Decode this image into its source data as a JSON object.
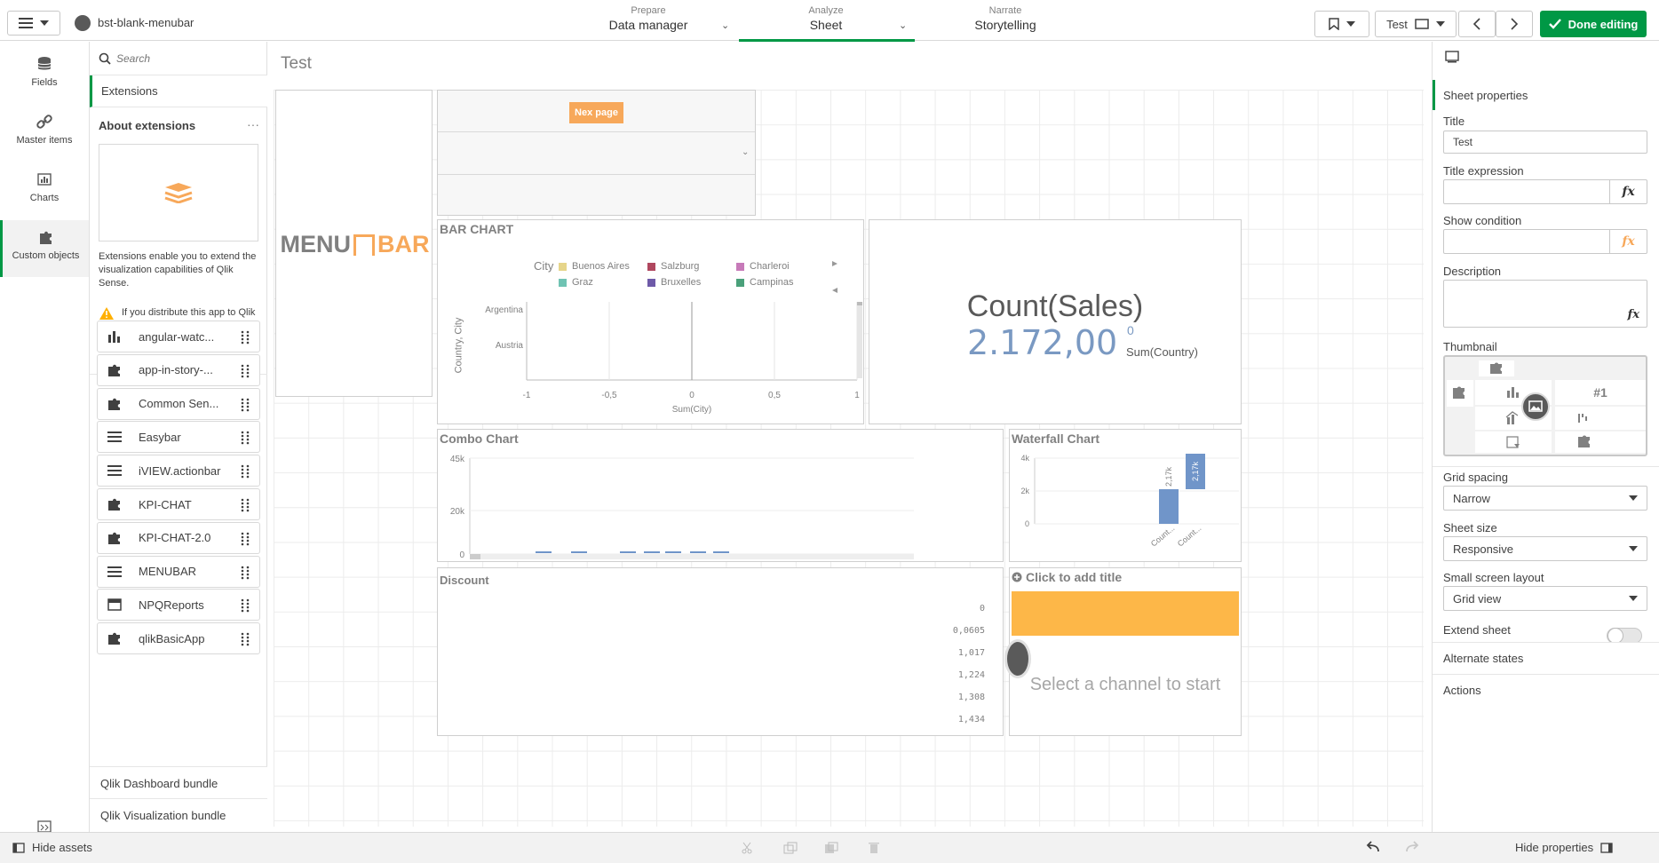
{
  "header": {
    "app_name": "bst-blank-menubar",
    "tabs": [
      {
        "small": "Prepare",
        "big": "Data manager"
      },
      {
        "small": "Analyze",
        "big": "Sheet"
      },
      {
        "small": "Narrate",
        "big": "Storytelling"
      }
    ],
    "sheet_selector": "Test",
    "done_label": "Done editing"
  },
  "rail": {
    "items": [
      {
        "label": "Fields",
        "icon": "database-icon"
      },
      {
        "label": "Master items",
        "icon": "link-icon"
      },
      {
        "label": "Charts",
        "icon": "bar-chart-icon"
      },
      {
        "label": "Custom objects",
        "icon": "puzzle-icon"
      }
    ]
  },
  "assets": {
    "search_placeholder": "Search",
    "tab": "Extensions",
    "about_title": "About extensions",
    "about_text": "Extensions enable you to extend the visualization capabilities of Qlik Sense.",
    "warning_text": "If you distribute this app to Qlik Cloud Services, extensions will not be available.",
    "items": [
      {
        "label": "angular-watc...",
        "icon": "bar-chart-icon"
      },
      {
        "label": "app-in-story-...",
        "icon": "puzzle-icon"
      },
      {
        "label": "Common Sen...",
        "icon": "puzzle-icon"
      },
      {
        "label": "Easybar",
        "icon": "lines-icon"
      },
      {
        "label": "iVIEW.actionbar",
        "icon": "lines-icon"
      },
      {
        "label": "KPI-CHAT",
        "icon": "puzzle-icon"
      },
      {
        "label": "KPI-CHAT-2.0",
        "icon": "puzzle-icon"
      },
      {
        "label": "MENUBAR",
        "icon": "lines-icon"
      },
      {
        "label": "NPQReports",
        "icon": "report-icon"
      },
      {
        "label": "qlikBasicApp",
        "icon": "puzzle-icon"
      }
    ],
    "bundles": [
      "Qlik Dashboard bundle",
      "Qlik Visualization bundle"
    ]
  },
  "canvas": {
    "sheet_title": "Test",
    "menubar_logo_left": "MENU",
    "menubar_logo_right": "BAR",
    "nex_page_label": "Nex page",
    "bar_chart": {
      "title": "BAR CHART",
      "legend_title": "City",
      "legend": [
        {
          "name": "Buenos Aires",
          "color": "#e6d58a"
        },
        {
          "name": "Salzburg",
          "color": "#b0475f"
        },
        {
          "name": "Charleroi",
          "color": "#c77ab9"
        },
        {
          "name": "Graz",
          "color": "#6fc3b3"
        },
        {
          "name": "Bruxelles",
          "color": "#6e5aa8"
        },
        {
          "name": "Campinas",
          "color": "#4aa07a"
        }
      ],
      "categories": [
        "Argentina",
        "Austria"
      ],
      "x_ticks": [
        "-1",
        "-0,5",
        "0",
        "0,5",
        "1"
      ],
      "xlabel": "Sum(City)",
      "ylabel": "Country, City"
    },
    "kpi": {
      "title": "Count(Sales)",
      "value": "2.172,00",
      "superscript": "0",
      "subtitle": "Sum(Country)"
    },
    "combo_chart": {
      "title": "Combo Chart",
      "y_ticks": [
        "45k",
        "20k",
        "0"
      ]
    },
    "waterfall_chart": {
      "title": "Waterfall Chart",
      "y_ticks": [
        "4k",
        "2k",
        "0"
      ],
      "bar_labels": [
        "2,17k",
        "2,17k"
      ],
      "x_labels": [
        "Count...",
        "Count..."
      ]
    },
    "discount": {
      "title": "Discount",
      "values": [
        "0",
        "0,0605",
        "1,017",
        "1,224",
        "1,308",
        "1,434"
      ]
    },
    "channel": {
      "title": "Click to add title",
      "placeholder": "Select a channel to start"
    }
  },
  "props": {
    "section": "Sheet properties",
    "title_label": "Title",
    "title_value": "Test",
    "title_expr_label": "Title expression",
    "show_cond_label": "Show condition",
    "description_label": "Description",
    "thumbnail_label": "Thumbnail",
    "thumbnail_kpi": "#1",
    "grid_spacing_label": "Grid spacing",
    "grid_spacing_value": "Narrow",
    "sheet_size_label": "Sheet size",
    "sheet_size_value": "Responsive",
    "small_layout_label": "Small screen layout",
    "small_layout_value": "Grid view",
    "extend_label": "Extend sheet",
    "alternate_states": "Alternate states",
    "actions": "Actions"
  },
  "footer": {
    "hide_assets": "Hide assets",
    "hide_properties": "Hide properties"
  },
  "colors": {
    "accent": "#009845",
    "orange": "#f7a85a",
    "kpi_blue": "#7a99c2",
    "waterfall_blue": "#7095c9",
    "channel_banner": "#fdb748"
  }
}
